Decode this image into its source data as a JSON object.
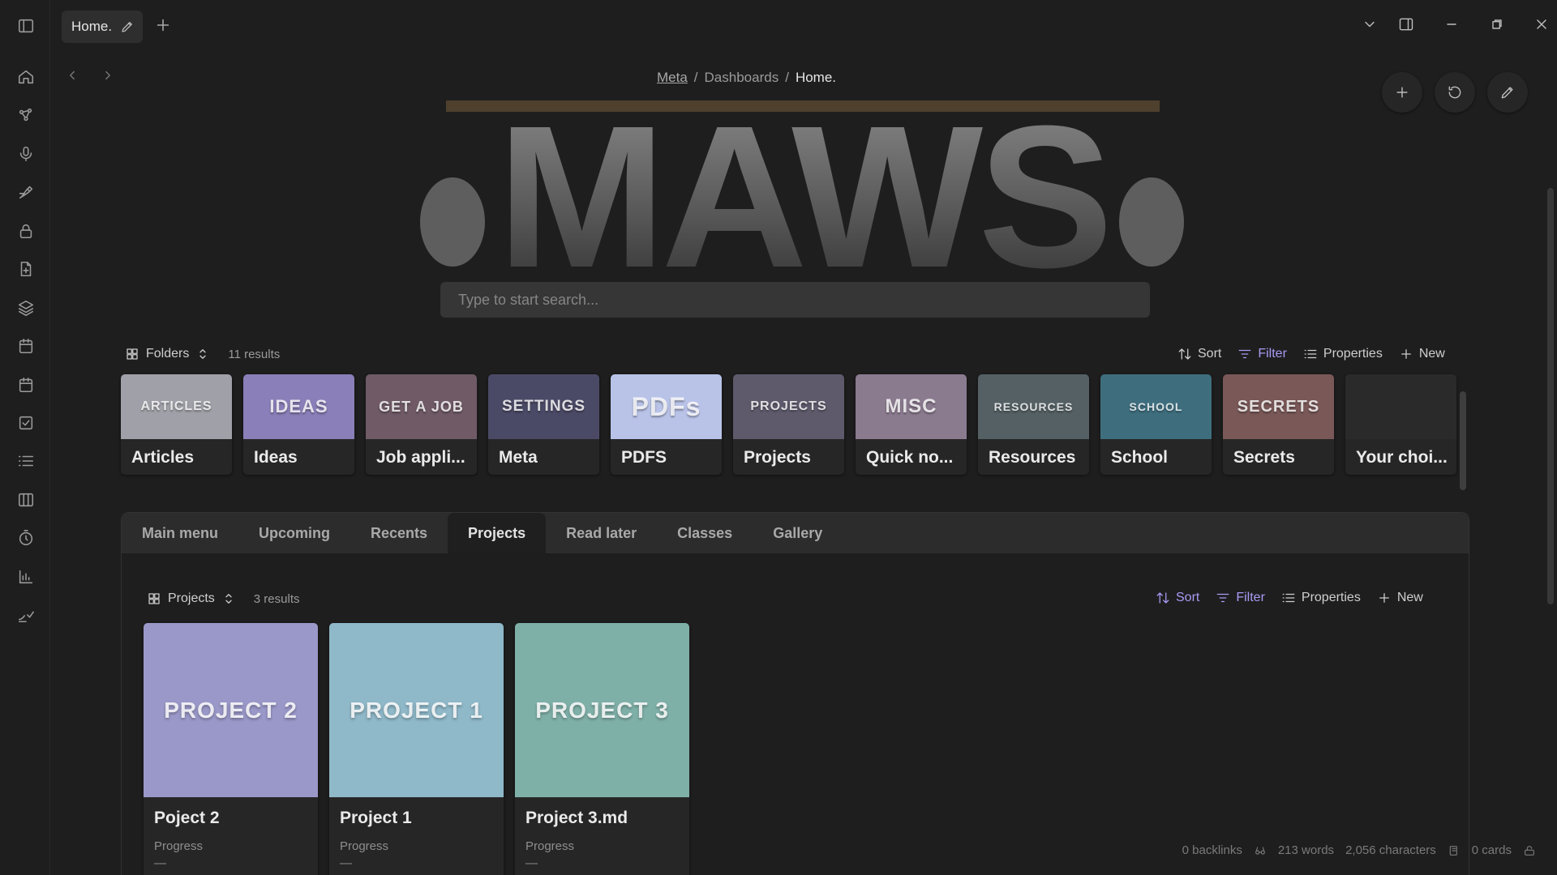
{
  "ribbon": {
    "icons": [
      "sidebar-toggle-icon",
      "home-icon",
      "graph-icon",
      "microphone-icon",
      "sign-icon",
      "lock-icon",
      "file-plus-icon",
      "layers-icon",
      "calendar-icon",
      "calendar-icon",
      "checkbox-icon",
      "list-icon",
      "columns-icon",
      "timer-icon",
      "bar-chart-icon",
      "sign-check-icon"
    ]
  },
  "tabs": {
    "active_title": "Home.",
    "new_tab": "+"
  },
  "breadcrumb": {
    "root": "Meta",
    "sep": "/",
    "middle": "Dashboards",
    "current": "Home."
  },
  "banner": {
    "text": "MAWS"
  },
  "search": {
    "placeholder": "Type to start search..."
  },
  "folders_base": {
    "view": "Folders",
    "count": "11 results",
    "sort": "Sort",
    "filter": "Filter",
    "properties": "Properties",
    "new": "New",
    "items": [
      {
        "name": "Articles",
        "thumb": "ARTICLES",
        "color": "#a0a0a8"
      },
      {
        "name": "Ideas",
        "thumb": "IDEAS",
        "color": "#8a7fb8"
      },
      {
        "name": "Job appli...",
        "thumb": "GET A JOB",
        "color": "#6f5a66"
      },
      {
        "name": "Meta",
        "thumb": "SETTINGS",
        "color": "#4b4a66"
      },
      {
        "name": "PDFS",
        "thumb": "PDFs",
        "color": "#b9c3e8"
      },
      {
        "name": "Projects",
        "thumb": "PROJECTS",
        "color": "#5e5a6b"
      },
      {
        "name": "Quick no...",
        "thumb": "MISC",
        "color": "#8b7b8f"
      },
      {
        "name": "Resources",
        "thumb": "RESOURCES",
        "color": "#546064"
      },
      {
        "name": "School",
        "thumb": "SCHOOL",
        "color": "#3e6e7e"
      },
      {
        "name": "Secrets",
        "thumb": "SECRETS",
        "color": "#7a5858"
      },
      {
        "name": "Your choi...",
        "thumb": "",
        "color": "#2a2a2a"
      }
    ]
  },
  "panel_tabs": [
    "Main menu",
    "Upcoming",
    "Recents",
    "Projects",
    "Read later",
    "Classes",
    "Gallery"
  ],
  "active_panel_tab": "Projects",
  "projects_base": {
    "view": "Projects",
    "count": "3 results",
    "sort": "Sort",
    "filter": "Filter",
    "properties": "Properties",
    "new": "New",
    "items": [
      {
        "name": "Poject 2",
        "thumb": "PROJECT 2",
        "prop": "Progress",
        "value": "—",
        "color": "#9a98c8"
      },
      {
        "name": "Project 1",
        "thumb": "PROJECT 1",
        "prop": "Progress",
        "value": "—",
        "color": "#8fb8c8"
      },
      {
        "name": "Project 3.md",
        "thumb": "PROJECT 3",
        "prop": "Progress",
        "value": "—",
        "color": "#7fb0a8"
      }
    ]
  },
  "status": {
    "backlinks": "0 backlinks",
    "words": "213 words",
    "characters": "2,056 characters",
    "cards": "0 cards"
  }
}
